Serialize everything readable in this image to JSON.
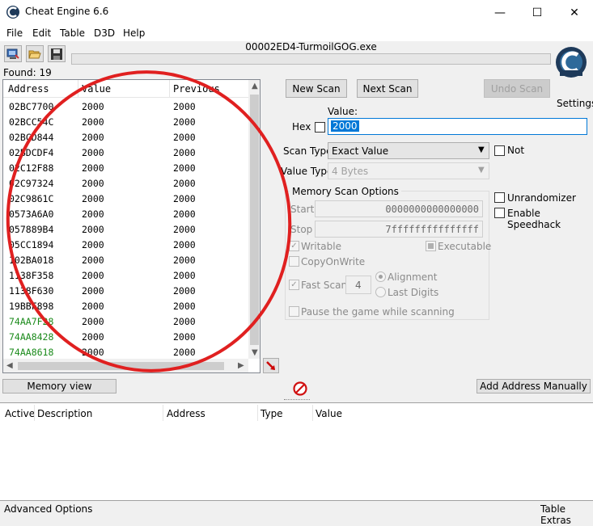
{
  "window": {
    "title": "Cheat Engine 6.6",
    "minimize": "—",
    "maximize": "☐",
    "close": "✕"
  },
  "menu": [
    "File",
    "Edit",
    "Table",
    "D3D",
    "Help"
  ],
  "process_name": "00002ED4-TurmoilGOG.exe",
  "found_label": "Found: 19",
  "results": {
    "columns": [
      "Address",
      "Value",
      "Previous"
    ],
    "rows": [
      {
        "address": "02BC7700",
        "value": "2000",
        "previous": "2000"
      },
      {
        "address": "02BCC54C",
        "value": "2000",
        "previous": "2000"
      },
      {
        "address": "02BCD844",
        "value": "2000",
        "previous": "2000"
      },
      {
        "address": "02BDCDF4",
        "value": "2000",
        "previous": "2000"
      },
      {
        "address": "02C12F88",
        "value": "2000",
        "previous": "2000"
      },
      {
        "address": "02C97324",
        "value": "2000",
        "previous": "2000"
      },
      {
        "address": "02C9861C",
        "value": "2000",
        "previous": "2000"
      },
      {
        "address": "0573A6A0",
        "value": "2000",
        "previous": "2000"
      },
      {
        "address": "057889B4",
        "value": "2000",
        "previous": "2000"
      },
      {
        "address": "05CC1894",
        "value": "2000",
        "previous": "2000"
      },
      {
        "address": "102BA018",
        "value": "2000",
        "previous": "2000"
      },
      {
        "address": "1138F358",
        "value": "2000",
        "previous": "2000"
      },
      {
        "address": "1138F630",
        "value": "2000",
        "previous": "2000"
      },
      {
        "address": "19BBF898",
        "value": "2000",
        "previous": "2000"
      },
      {
        "address": "74AA7F28",
        "value": "2000",
        "previous": "2000",
        "static": true
      },
      {
        "address": "74AA8428",
        "value": "2000",
        "previous": "2000",
        "static": true
      },
      {
        "address": "74AA8618",
        "value": "2000",
        "previous": "2000",
        "static": true
      }
    ]
  },
  "buttons": {
    "new_scan": "New Scan",
    "next_scan": "Next Scan",
    "undo_scan": "Undo Scan",
    "memory_view": "Memory view",
    "add_address": "Add Address Manually"
  },
  "settings_label": "Settings",
  "value_label": "Value:",
  "hex_label": "Hex",
  "value_input": "2000",
  "scan_type_label": "Scan Type",
  "scan_type_value": "Exact Value",
  "value_type_label": "Value Type",
  "value_type_value": "4 Bytes",
  "not_label": "Not",
  "memory_scan_options": {
    "title": "Memory Scan Options",
    "start_label": "Start",
    "start_value": "0000000000000000",
    "stop_label": "Stop",
    "stop_value": "7fffffffffffffff",
    "writable": "Writable",
    "executable": "Executable",
    "copyonwrite": "CopyOnWrite",
    "fast_scan": "Fast Scan",
    "fast_scan_value": "4",
    "alignment": "Alignment",
    "last_digits": "Last Digits",
    "pause": "Pause the game while scanning"
  },
  "unrandomizer": "Unrandomizer",
  "speedhack": "Enable Speedhack",
  "address_table": {
    "columns": [
      "Active",
      "Description",
      "Address",
      "Type",
      "Value"
    ]
  },
  "footer": {
    "advanced": "Advanced Options",
    "extras": "Table Extras"
  },
  "colors": {
    "static_address": "#1a8a1a",
    "annotation_circle": "#e02020",
    "selection": "#0078d7"
  }
}
